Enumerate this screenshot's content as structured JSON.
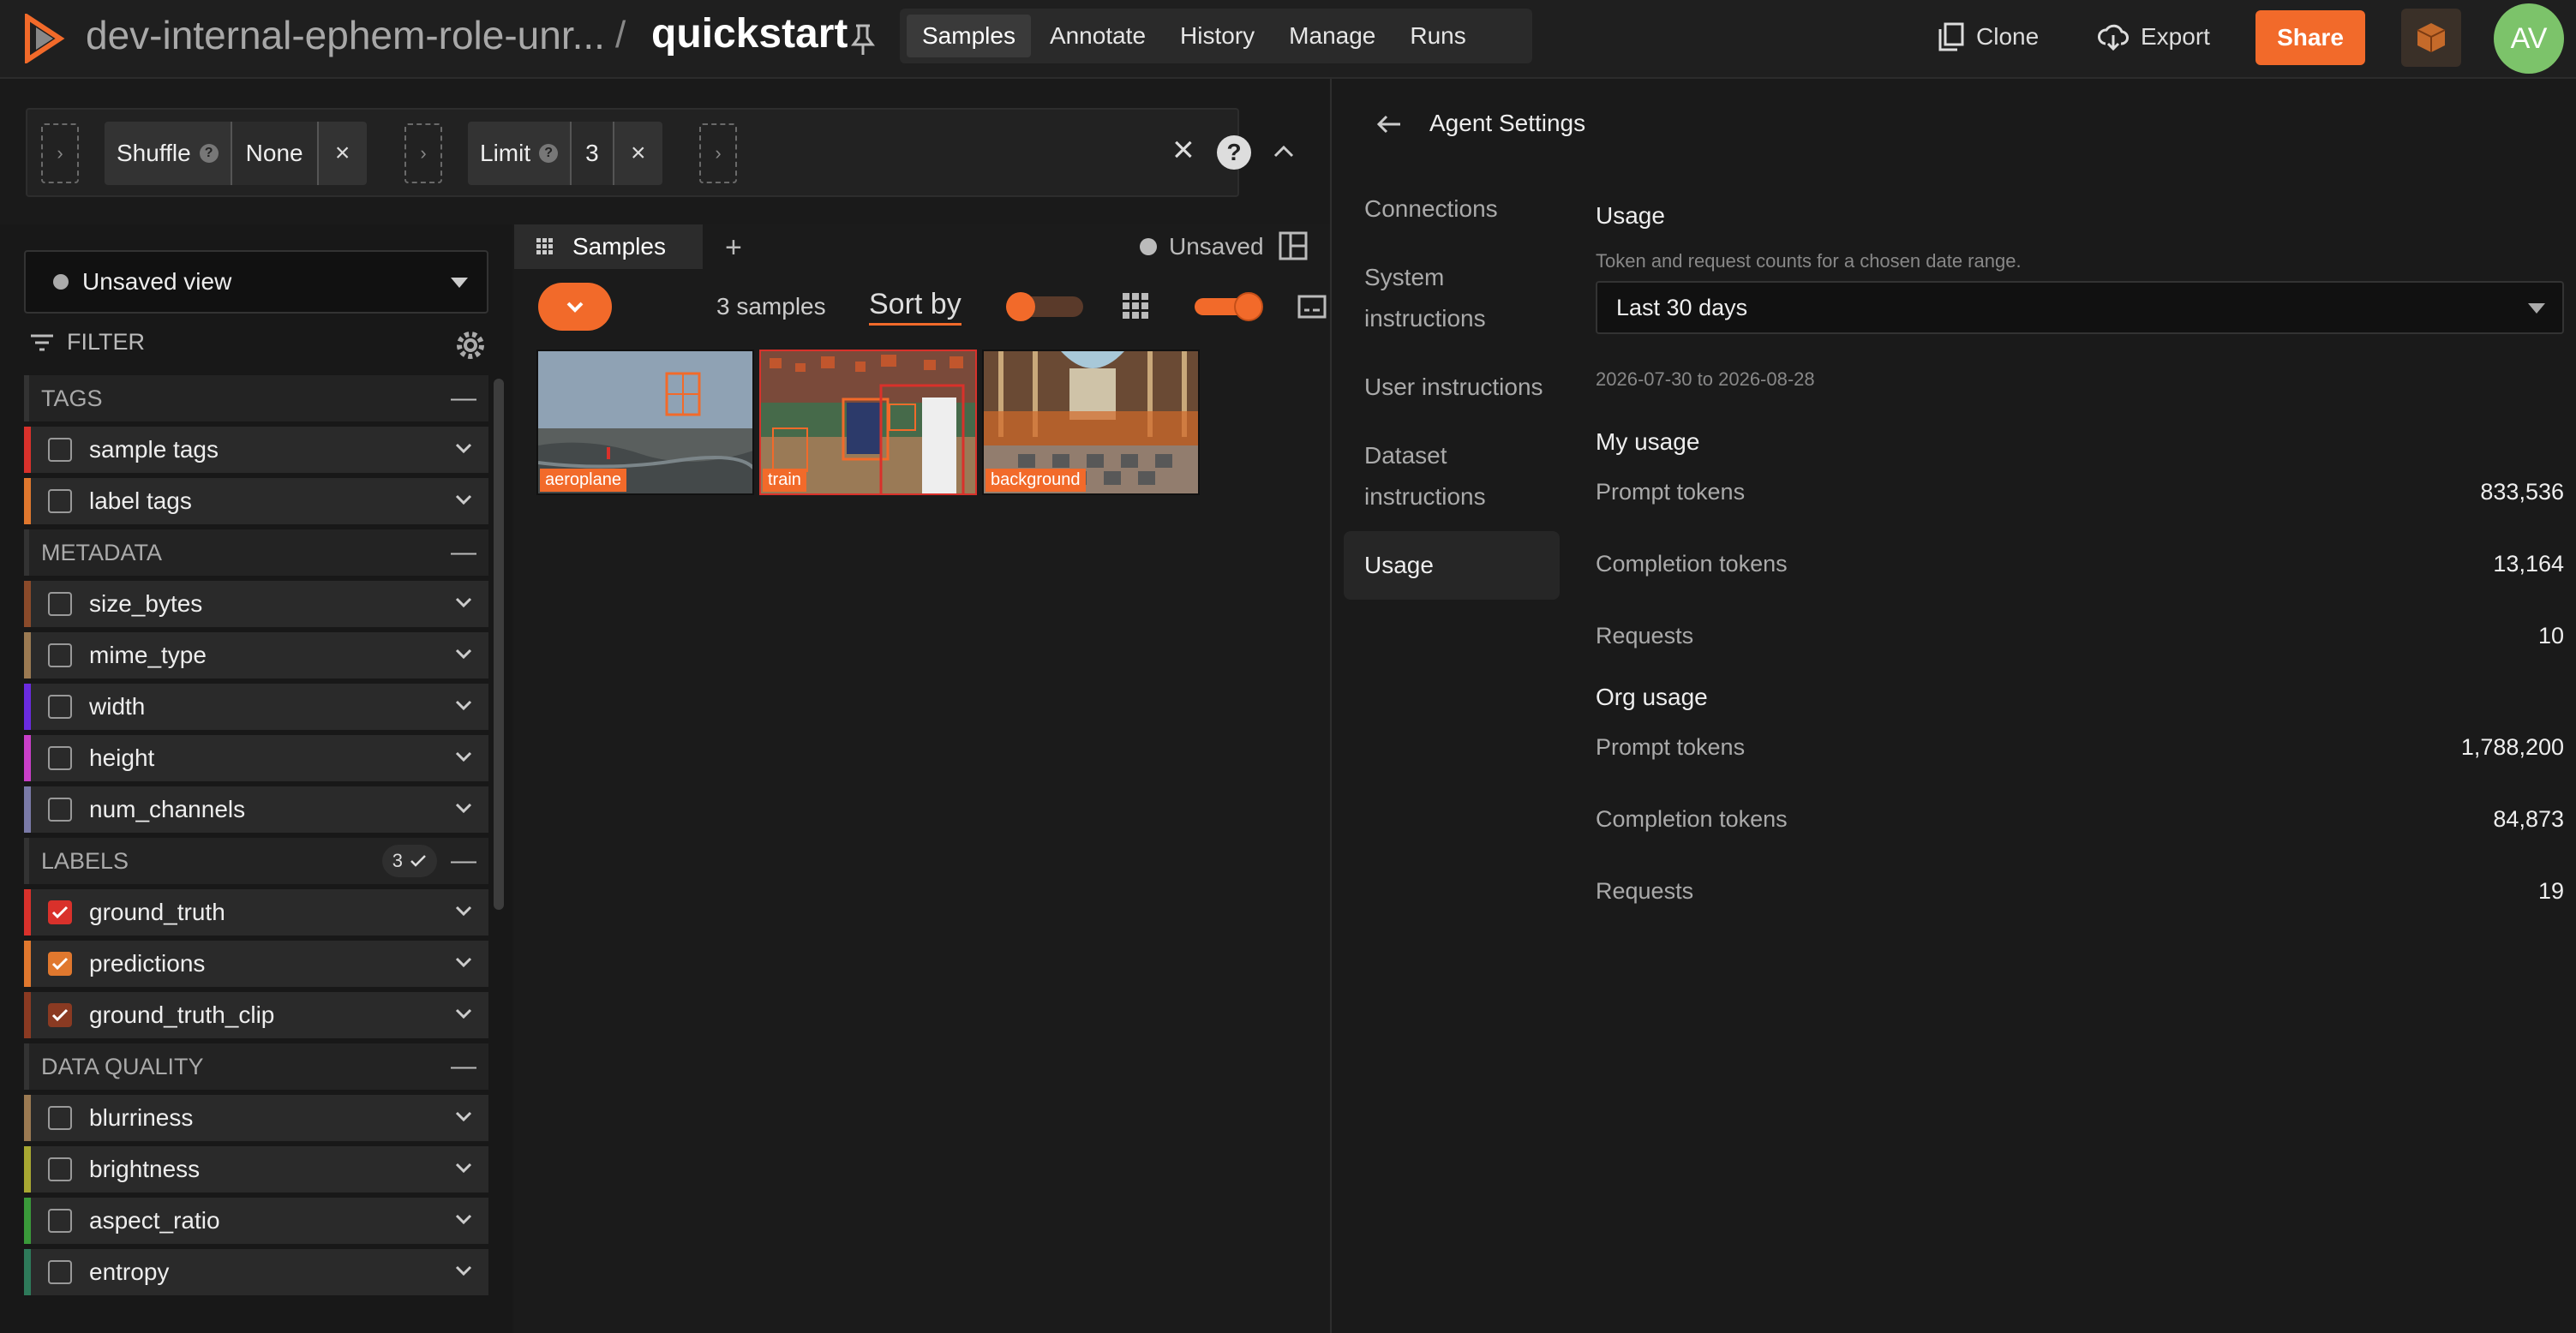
{
  "header": {
    "dataset_name": "dev-internal-ephem-role-unr...",
    "separator": "/",
    "dataset_quick": "quickstart",
    "tabs": [
      {
        "label": "Samples",
        "active": true
      },
      {
        "label": "Annotate",
        "active": false
      },
      {
        "label": "History",
        "active": false
      },
      {
        "label": "Manage",
        "active": false
      },
      {
        "label": "Runs",
        "active": false
      }
    ],
    "clone_label": "Clone",
    "export_label": "Export",
    "share_label": "Share",
    "avatar_initials": "AV",
    "accent": "#f26a2a"
  },
  "view_bar": {
    "shuffle_label": "Shuffle",
    "shuffle_value": "None",
    "limit_label": "Limit",
    "limit_value": "3",
    "help_glyph": "?",
    "expand_glyph": "›",
    "remove_glyph": "×",
    "clear_glyph": "×"
  },
  "sidebar": {
    "view_name": "Unsaved view",
    "filter_label": "FILTER",
    "groups": [
      {
        "title": "TAGS",
        "fields": [
          {
            "label": "sample tags",
            "color": "#d9312b",
            "checked": false
          },
          {
            "label": "label tags",
            "color": "#e0782e",
            "checked": false
          }
        ]
      },
      {
        "title": "METADATA",
        "fields": [
          {
            "label": "size_bytes",
            "color": "#8a4a2a",
            "checked": false
          },
          {
            "label": "mime_type",
            "color": "#9b7a52",
            "checked": false
          },
          {
            "label": "width",
            "color": "#6a2be0",
            "checked": false
          },
          {
            "label": "height",
            "color": "#c93fc9",
            "checked": false
          },
          {
            "label": "num_channels",
            "color": "#7a7aa8",
            "checked": false
          }
        ]
      },
      {
        "title": "LABELS",
        "count": "3",
        "fields": [
          {
            "label": "ground_truth",
            "color": "#d9312b",
            "checked": true
          },
          {
            "label": "predictions",
            "color": "#e0782e",
            "checked": true
          },
          {
            "label": "ground_truth_clip",
            "color": "#8a3a22",
            "checked": true
          }
        ]
      },
      {
        "title": "DATA QUALITY",
        "fields": [
          {
            "label": "blurriness",
            "color": "#9b7a52",
            "checked": false
          },
          {
            "label": "brightness",
            "color": "#a8a832",
            "checked": false
          },
          {
            "label": "aspect_ratio",
            "color": "#3a9a3a",
            "checked": false
          },
          {
            "label": "entropy",
            "color": "#2e7a5a",
            "checked": false
          }
        ]
      }
    ]
  },
  "grid": {
    "tab_label": "Samples",
    "add_glyph": "+",
    "unsaved_label": "Unsaved",
    "samples_count": "3 samples",
    "sort_label": "Sort by",
    "thumbnails": [
      {
        "label": "aeroplane"
      },
      {
        "label": "train"
      },
      {
        "label": "background"
      }
    ]
  },
  "panel": {
    "title": "Agent Settings",
    "nav": [
      {
        "label": "Connections",
        "active": false
      },
      {
        "label": "System instructions",
        "active": false
      },
      {
        "label": "User instructions",
        "active": false
      },
      {
        "label": "Dataset instructions",
        "active": false
      },
      {
        "label": "Usage",
        "active": true
      }
    ],
    "usage": {
      "title": "Usage",
      "description": "Token and request counts for a chosen date range.",
      "range_value": "Last 30 days",
      "date_range": "2026-07-30 to 2026-08-28",
      "my_usage_title": "My usage",
      "my_usage": [
        {
          "label": "Prompt tokens",
          "value": "833,536"
        },
        {
          "label": "Completion tokens",
          "value": "13,164"
        },
        {
          "label": "Requests",
          "value": "10"
        }
      ],
      "org_usage_title": "Org usage",
      "org_usage": [
        {
          "label": "Prompt tokens",
          "value": "1,788,200"
        },
        {
          "label": "Completion tokens",
          "value": "84,873"
        },
        {
          "label": "Requests",
          "value": "19"
        }
      ]
    }
  }
}
